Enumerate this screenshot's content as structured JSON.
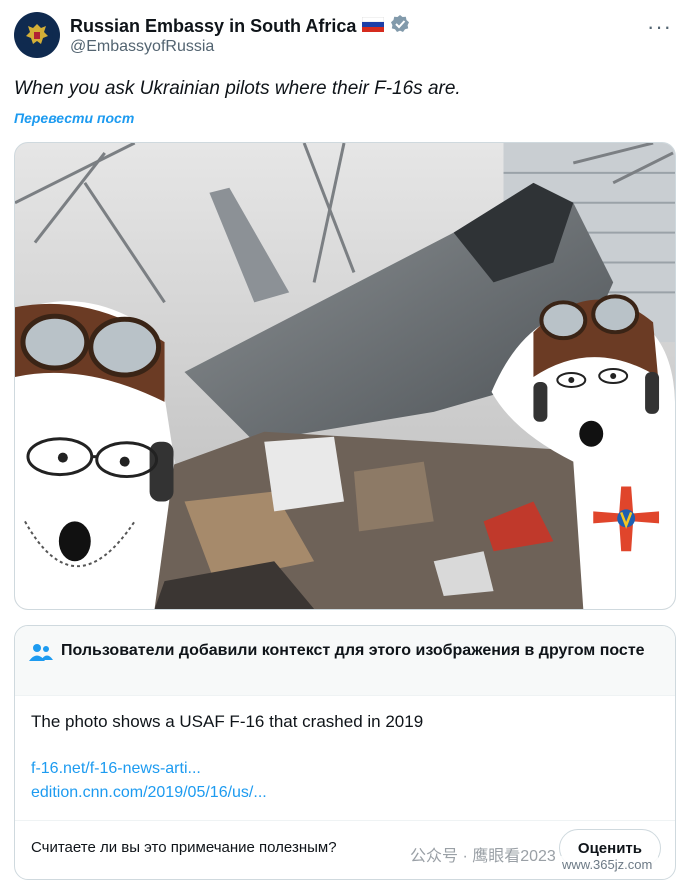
{
  "post": {
    "display_name": "Russian Embassy in South Africa",
    "flag": "🇷🇺",
    "handle": "@EmbassyofRussia",
    "more": "···",
    "text": "When you ask Ukrainian pilots where their F-16s are.",
    "translate_label": "Перевести пост"
  },
  "media": {
    "icon": "crashed-jet-meme-image"
  },
  "community_note": {
    "title": "Пользователи добавили контекст для этого изображения в другом посте",
    "body": "The photo shows a USAF F-16 that crashed in 2019",
    "links": [
      "f-16.net/f-16-news-arti...",
      "edition.cnn.com/2019/05/16/us/..."
    ],
    "question": "Считаете ли вы это примечание полезным?",
    "rate_label": "Оценить"
  },
  "watermark": {
    "text": "公众号 · 鹰眼看2023",
    "site": "www.365jz.com"
  },
  "colors": {
    "accent": "#1d9bf0",
    "verified": "#829aab",
    "text": "#0f1419",
    "secondary": "#536471"
  }
}
